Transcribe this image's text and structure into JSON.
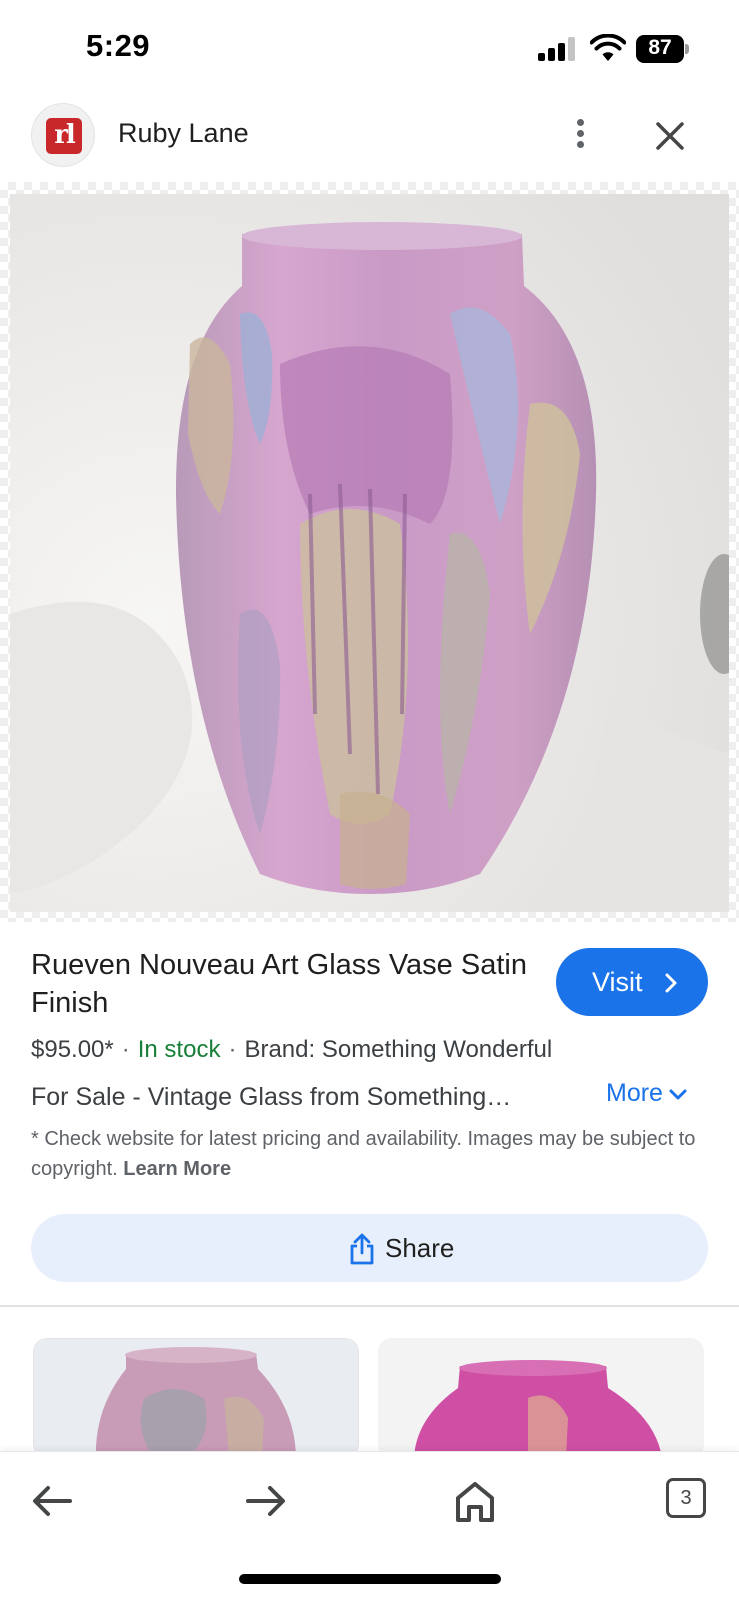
{
  "status_bar": {
    "time": "5:29",
    "battery": "87"
  },
  "header": {
    "site_logo_text": "rl",
    "site_name": "Ruby Lane"
  },
  "product": {
    "title": "Rueven Nouveau Art Glass Vase Satin Finish",
    "visit_label": "Visit",
    "price": "$95.00*",
    "stock": "In stock",
    "brand": "Brand: Something Wonderful",
    "description": "For Sale - Vintage Glass from Something…",
    "more_label": "More",
    "disclaimer": "* Check website for latest pricing and availability. Images may be subject to copyright.",
    "learn_more": "Learn More",
    "share_label": "Share"
  },
  "bottom_nav": {
    "tab_count": "3"
  },
  "colors": {
    "accent": "#1a73e8",
    "stock_green": "#188038",
    "share_bg": "#e8effc",
    "logo_red": "#c8282a"
  }
}
